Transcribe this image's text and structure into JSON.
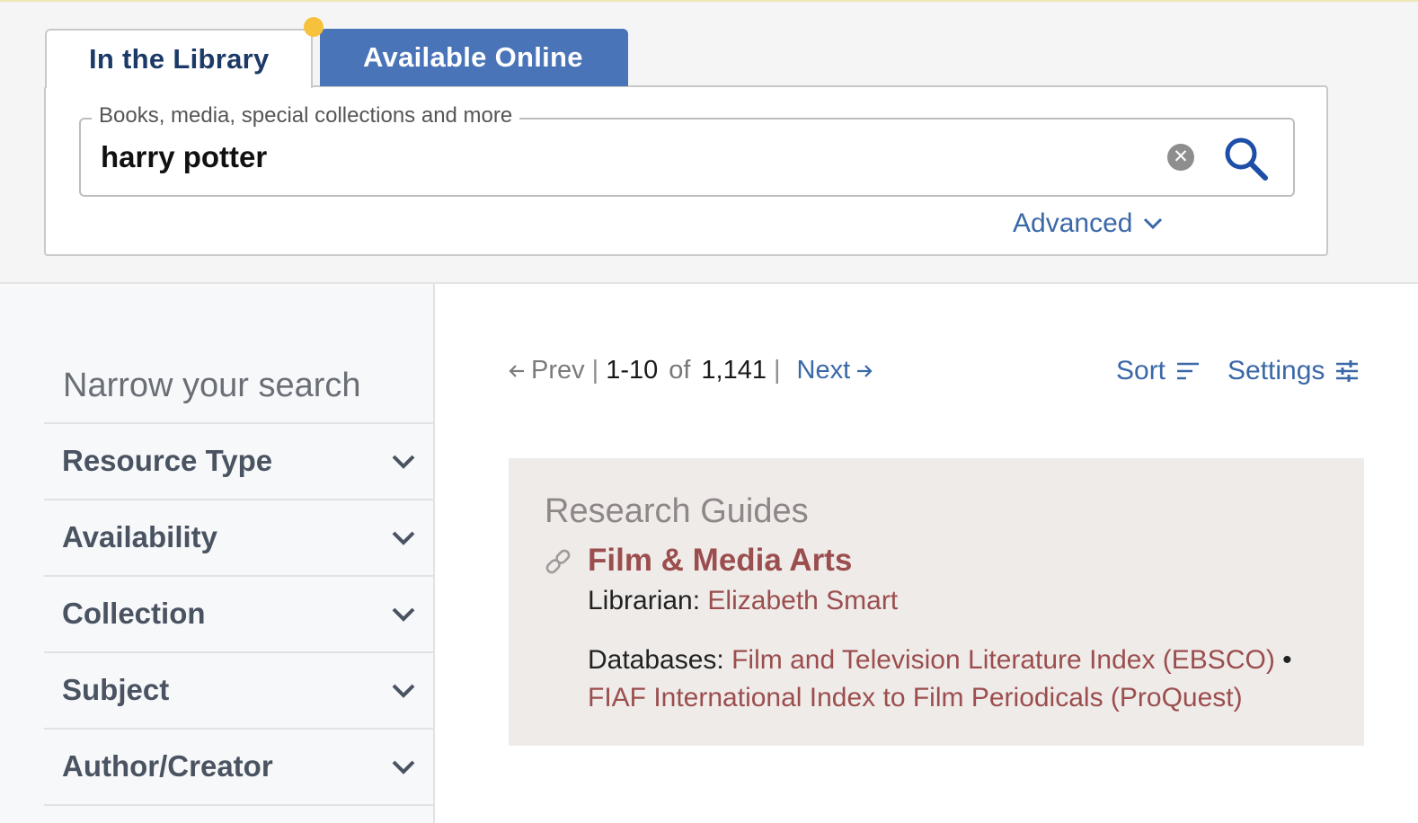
{
  "tabs": [
    {
      "label": "In the Library",
      "active": true
    },
    {
      "label": "Available Online",
      "active": false
    }
  ],
  "search": {
    "legend": "Books, media, special collections and more",
    "value": "harry potter",
    "clear_glyph": "✕",
    "advanced_label": "Advanced"
  },
  "sidebar": {
    "title": "Narrow your search",
    "facets": [
      "Resource Type",
      "Availability",
      "Collection",
      "Subject",
      "Author/Creator"
    ]
  },
  "pager": {
    "prev_label": "Prev",
    "range": "1-10",
    "of": "of",
    "total": "1,141",
    "next_label": "Next",
    "separator": "|"
  },
  "toolbar": {
    "sort_label": "Sort",
    "settings_label": "Settings"
  },
  "research_guides": {
    "heading": "Research Guides",
    "title": "Film & Media Arts",
    "librarian_label": "Librarian:",
    "librarian_name": "Elizabeth Smart",
    "databases_label": "Databases:",
    "databases": [
      "Film and Television Literature Index (EBSCO)",
      "FIAF International Index to Film Periodicals (ProQuest)"
    ],
    "bullet": "•"
  },
  "colors": {
    "accent_blue": "#3a68a8",
    "tab_blue": "#4a74b8",
    "guide_red": "#9b4e4e",
    "tab_dot": "#f7c23b"
  }
}
